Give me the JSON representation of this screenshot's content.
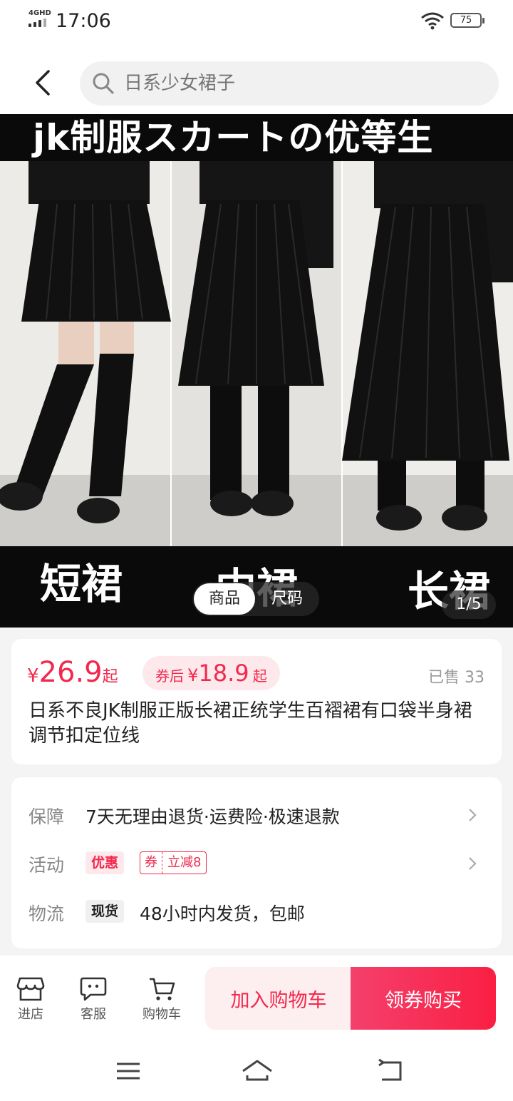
{
  "status_bar": {
    "network": "4GHD",
    "time": "17:06",
    "battery": "75"
  },
  "header": {
    "search_placeholder": "日系少女裙子"
  },
  "gallery": {
    "banner_text": "jk制服スカートの优等生",
    "captions": [
      "短裙",
      "中裙",
      "长裙"
    ],
    "tabs": [
      "商品",
      "尺码"
    ],
    "active_tab": "商品",
    "counter": "1/5"
  },
  "price": {
    "currency": "¥",
    "value": "26.9",
    "suffix": "起",
    "coupon_label": "券后",
    "coupon_value": "18.9",
    "sold": "已售 33",
    "title": "日系不良JK制服正版长裙正统学生百褶裙有口袋半身裙调节扣定位线"
  },
  "services": {
    "guarantee_label": "保障",
    "guarantee_text": "7天无理由退货·运费险·极速退款",
    "promo_label": "活动",
    "promo_tag": "优惠",
    "coupon_tag_left": "券",
    "coupon_tag_right": "立减8",
    "logistics_label": "物流",
    "logistics_tag": "现货",
    "logistics_text": "48小时内发货，包邮"
  },
  "bottom_bar": {
    "store": "进店",
    "service": "客服",
    "cart": "购物车",
    "add_cart": "加入购物车",
    "buy": "领券购买"
  },
  "colors": {
    "accent": "#f2294d",
    "accent_light": "#fde9ec"
  }
}
